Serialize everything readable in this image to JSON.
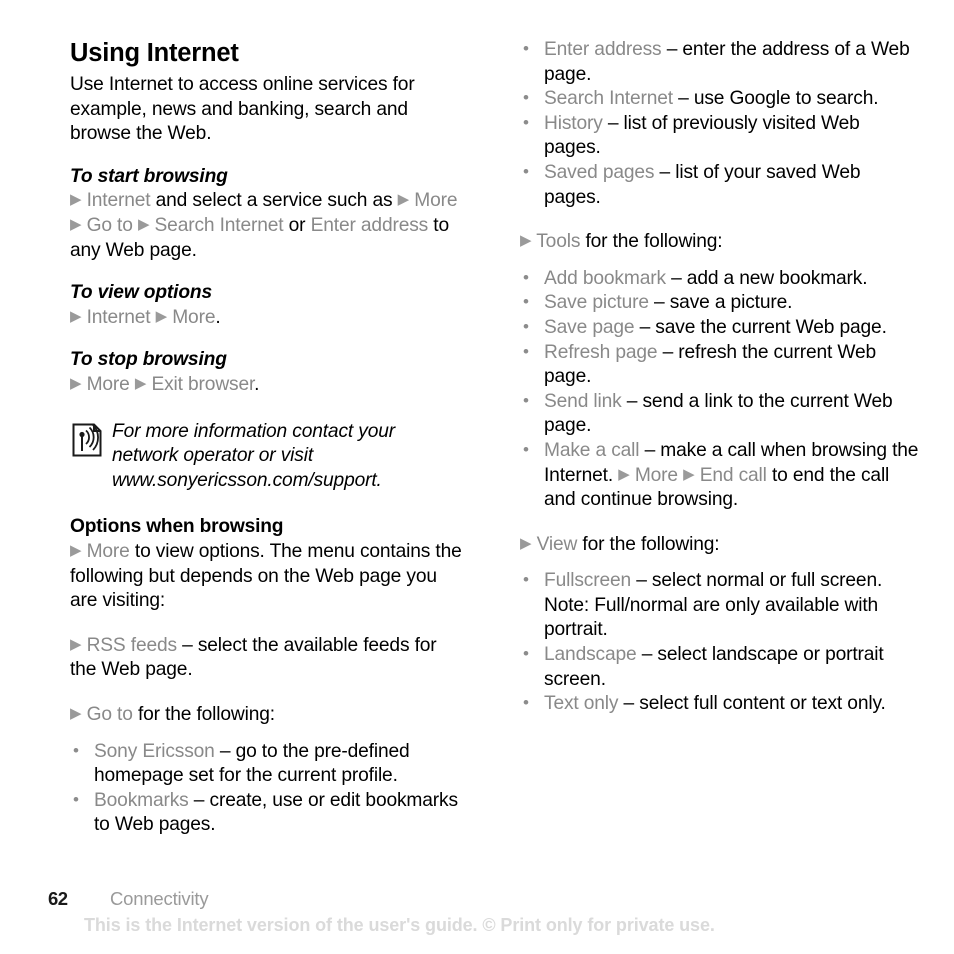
{
  "document": {
    "title": "Using Internet",
    "intro": "Use Internet to access online services for example, news and banking, search and browse the Web."
  },
  "left_column": {
    "start_browsing": {
      "heading": "To start browsing",
      "arrow1": "▶",
      "menu1": "Internet",
      "text1": " and select a service such as ",
      "arrow2": "▶",
      "menu2": "More",
      "arrow3": "▶",
      "menu3": "Go to",
      "arrow4": "▶",
      "menu4": "Search Internet",
      "text2": " or ",
      "menu5": "Enter address",
      "text3": " to any Web page."
    },
    "view_options": {
      "heading": "To view options",
      "arrow1": "▶",
      "menu1": "Internet",
      "arrow2": "▶",
      "menu2": "More",
      "text1": "."
    },
    "stop_browsing": {
      "heading": "To stop browsing",
      "arrow1": "▶",
      "menu1": "More",
      "arrow2": "▶",
      "menu2": "Exit browser",
      "text1": "."
    },
    "note": {
      "icon": "note-antenna-icon",
      "text": "For more information contact your network operator or visit www.sonyericsson.com/support."
    },
    "options_when_browsing": {
      "heading": "Options when browsing",
      "arrow1": "▶",
      "menu1": "More",
      "text1": " to view options. The menu contains the following but depends on the Web page you are visiting:"
    },
    "rss_feeds": {
      "arrow": "▶",
      "menu": "RSS feeds",
      "text": " – select the available feeds for the Web page."
    },
    "go_to": {
      "arrow": "▶",
      "menu": "Go to",
      "text": " for the following:"
    },
    "go_to_items": [
      {
        "menu": "Sony Ericsson",
        "text": " – go to the pre-defined homepage set for the current profile."
      },
      {
        "menu": "Bookmarks",
        "text": " – create, use or edit bookmarks to Web pages."
      }
    ]
  },
  "right_column": {
    "go_to_items_continued": [
      {
        "menu": "Enter address",
        "text": " – enter the address of a Web page."
      },
      {
        "menu": "Search Internet",
        "text": " – use Google to search."
      },
      {
        "menu": "History",
        "text": " – list of previously visited Web pages."
      },
      {
        "menu": "Saved pages",
        "text": " – list of your saved Web pages."
      }
    ],
    "tools": {
      "arrow": "▶",
      "menu": "Tools",
      "text": " for the following:"
    },
    "tools_items": [
      {
        "menu": "Add bookmark",
        "text": " – add a new bookmark."
      },
      {
        "menu": "Save picture",
        "text": " – save a picture."
      },
      {
        "menu": "Save page",
        "text": " – save the current Web page."
      },
      {
        "menu": "Refresh page",
        "text": " – refresh the current Web page."
      },
      {
        "menu": "Send link",
        "text": " – send a link to the current Web page."
      }
    ],
    "make_a_call": {
      "menu": "Make a call",
      "text1": " – make a call when browsing the Internet. ",
      "arrow1": "▶",
      "menu2": "More",
      "arrow2": "▶",
      "menu3": "End call",
      "text2": " to end the call and continue browsing."
    },
    "view": {
      "arrow": "▶",
      "menu": "View",
      "text": " for the following:"
    },
    "view_items": [
      {
        "menu": "Fullscreen",
        "text": " – select normal or full screen. Note: Full/normal are only available with portrait."
      },
      {
        "menu": "Landscape",
        "text": " – select landscape or portrait screen."
      },
      {
        "menu": "Text only",
        "text": " – select full content or text only."
      }
    ]
  },
  "footer": {
    "page_number": "62",
    "section": "Connectivity",
    "watermark": "This is the Internet version of the user's guide. © Print only for private use."
  },
  "colors": {
    "menu_gray": "#898989",
    "arrow_gray": "#9a9a9a",
    "watermark_gray": "#dadada",
    "text_black": "#000000"
  }
}
